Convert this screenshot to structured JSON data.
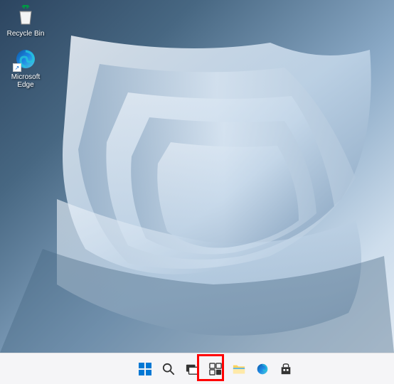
{
  "desktop": {
    "icons": [
      {
        "name": "recycle-bin",
        "label": "Recycle Bin"
      },
      {
        "name": "microsoft-edge",
        "label": "Microsoft Edge"
      }
    ]
  },
  "taskbar": {
    "items": [
      {
        "name": "start-button"
      },
      {
        "name": "search-button"
      },
      {
        "name": "task-view-button"
      },
      {
        "name": "widgets-button"
      },
      {
        "name": "file-explorer-button"
      },
      {
        "name": "edge-button"
      },
      {
        "name": "store-button"
      }
    ]
  },
  "annotations": {
    "highlight": "start-button"
  }
}
